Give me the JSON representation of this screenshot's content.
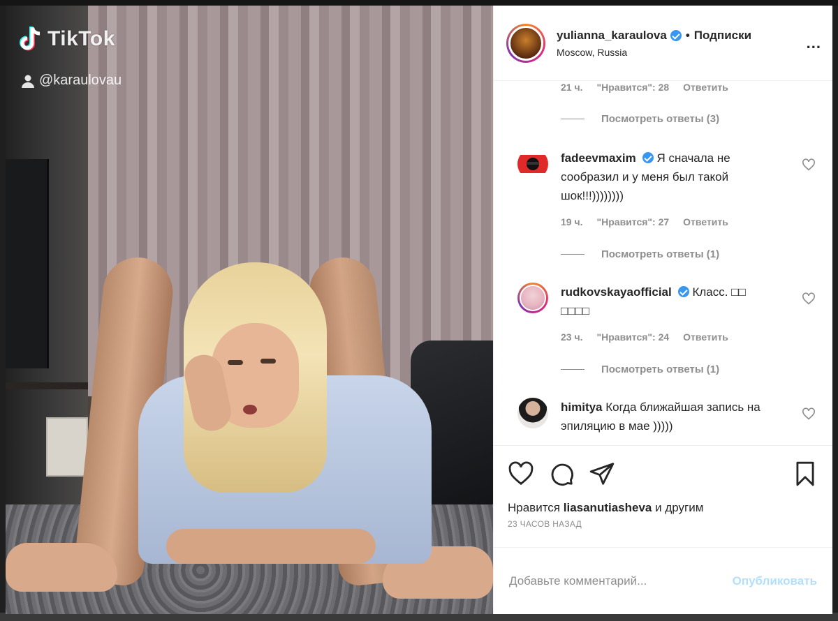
{
  "media": {
    "brand": "TikTok",
    "handle": "@karaulovau"
  },
  "header": {
    "username": "yulianna_karaulova",
    "separator": "•",
    "follow_label": "Подписки",
    "location": "Moscow, Russia",
    "more_label": "..."
  },
  "comments": {
    "top_meta": {
      "time": "21 ч.",
      "likes": "\"Нравится\": 28",
      "reply": "Ответить"
    },
    "top_replies": "Посмотреть ответы (3)",
    "items": [
      {
        "username": "fadeevmaxim",
        "text": "Я сначала не сообразил и у меня был такой шок!!!))))))))",
        "time": "19 ч.",
        "likes": "\"Нравится\": 27",
        "reply": "Ответить",
        "replies": "Посмотреть ответы (1)"
      },
      {
        "username": "rudkovskayaofficial",
        "text": "Класс. □□ □□□□",
        "time": "23 ч.",
        "likes": "\"Нравится\": 24",
        "reply": "Ответить",
        "replies": "Посмотреть ответы (1)"
      },
      {
        "username": "himitya",
        "text": "Когда ближайшая запись на эпиляцию в мае )))))"
      }
    ]
  },
  "likes": {
    "prefix": "Нравится",
    "user": "liasanutiasheva",
    "suffix": "и другим"
  },
  "timestamp": "23 ЧАСОВ НАЗАД",
  "add_comment": {
    "placeholder": "Добавьте комментарий...",
    "publish": "Опубликовать"
  },
  "colors": {
    "verified": "#3897f0",
    "publish_disabled": "#b2dffc",
    "muted": "#8e8e8e"
  }
}
